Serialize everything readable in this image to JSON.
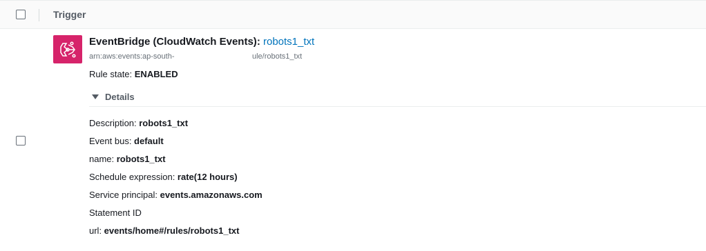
{
  "header": {
    "column_label": "Trigger"
  },
  "trigger": {
    "icon": "eventbridge-icon",
    "icon_color": "#d6236a",
    "service_name": "EventBridge (CloudWatch Events)",
    "separator": ": ",
    "rule_link": "robots1_txt",
    "arn_prefix": "arn:aws:events:ap-south-",
    "arn_suffix": "ule/robots1_txt",
    "rule_state_label": "Rule state: ",
    "rule_state_value": "ENABLED"
  },
  "details": {
    "toggle_label": "Details",
    "rows": [
      {
        "label": "Description: ",
        "value": "robots1_txt"
      },
      {
        "label": "Event bus: ",
        "value": "default"
      },
      {
        "label": "name: ",
        "value": "robots1_txt"
      },
      {
        "label": "Schedule expression: ",
        "value": "rate(12 hours)"
      },
      {
        "label": "Service principal: ",
        "value": "events.amazonaws.com"
      },
      {
        "label": "Statement ID",
        "value": ""
      },
      {
        "label": "url: ",
        "value": "events/home#/rules/robots1_txt"
      }
    ]
  },
  "colors": {
    "link": "#0073bb",
    "text": "#16191f",
    "muted": "#687078"
  }
}
